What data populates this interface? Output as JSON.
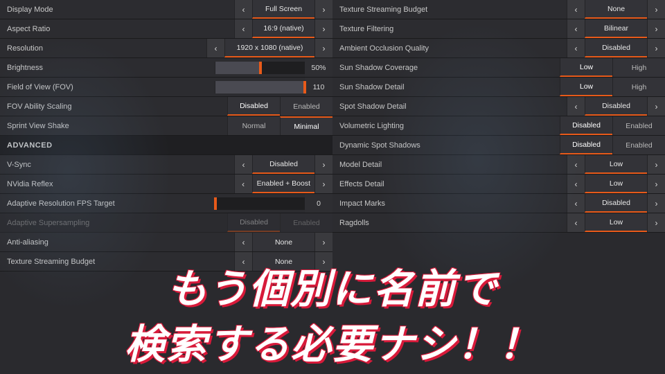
{
  "left": [
    {
      "type": "selector",
      "label": "Display Mode",
      "value": "Full Screen",
      "accent": "bottom"
    },
    {
      "type": "selector",
      "label": "Aspect Ratio",
      "value": "16:9 (native)",
      "accent": "bottom"
    },
    {
      "type": "selector",
      "label": "Resolution",
      "value": "1920 x 1080 (native)",
      "accent": "bottom",
      "wide": true
    },
    {
      "type": "slider",
      "label": "Brightness",
      "fill": 50,
      "readout": "50%"
    },
    {
      "type": "slider",
      "label": "Field of View (FOV)",
      "fill": 100,
      "readout": "110"
    },
    {
      "type": "pair",
      "label": "FOV Ability Scaling",
      "a": "Disabled",
      "b": "Enabled",
      "sel": "a",
      "accent": "bottom"
    },
    {
      "type": "pair",
      "label": "Sprint View Shake",
      "a": "Normal",
      "b": "Minimal",
      "sel": "b",
      "accent": "top"
    },
    {
      "type": "section",
      "label": "ADVANCED"
    },
    {
      "type": "selector",
      "label": "V-Sync",
      "value": "Disabled",
      "accent": "bottom"
    },
    {
      "type": "selector",
      "label": "NVidia Reflex",
      "value": "Enabled + Boost",
      "accent": "bottom"
    },
    {
      "type": "slider",
      "label": "Adaptive Resolution FPS Target",
      "fill": 0,
      "readout": "0"
    },
    {
      "type": "pair",
      "label": "Adaptive Supersampling",
      "a": "Disabled",
      "b": "Enabled",
      "sel": "a",
      "dim": true
    },
    {
      "type": "selector",
      "label": "Anti-aliasing",
      "value": "None"
    },
    {
      "type": "selector",
      "label": "Texture Streaming Budget",
      "value": "None"
    }
  ],
  "right": [
    {
      "type": "selector",
      "label": "Texture Streaming Budget",
      "value": "None",
      "accent": "bottom"
    },
    {
      "type": "selector",
      "label": "Texture Filtering",
      "value": "Bilinear",
      "accent": "bottom"
    },
    {
      "type": "selector",
      "label": "Ambient Occlusion Quality",
      "value": "Disabled",
      "accent": "bottom"
    },
    {
      "type": "pair",
      "label": "Sun Shadow Coverage",
      "a": "Low",
      "b": "High",
      "sel": "a",
      "accent": "bottom"
    },
    {
      "type": "pair",
      "label": "Sun Shadow Detail",
      "a": "Low",
      "b": "High",
      "sel": "a",
      "accent": "bottom"
    },
    {
      "type": "selector",
      "label": "Spot Shadow Detail",
      "value": "Disabled",
      "accent": "bottom"
    },
    {
      "type": "pair",
      "label": "Volumetric Lighting",
      "a": "Disabled",
      "b": "Enabled",
      "sel": "a",
      "accent": "bottom"
    },
    {
      "type": "pair",
      "label": "Dynamic Spot Shadows",
      "a": "Disabled",
      "b": "Enabled",
      "sel": "a",
      "accent": "bottom"
    },
    {
      "type": "selector",
      "label": "Model Detail",
      "value": "Low",
      "accent": "bottom"
    },
    {
      "type": "selector",
      "label": "Effects Detail",
      "value": "Low",
      "accent": "bottom"
    },
    {
      "type": "selector",
      "label": "Impact Marks",
      "value": "Disabled",
      "accent": "bottom"
    },
    {
      "type": "selector",
      "label": "Ragdolls",
      "value": "Low",
      "accent": "bottom"
    }
  ],
  "overlay": {
    "line1": "もう個別に名前で",
    "line2": "検索する必要ナシ！！"
  }
}
